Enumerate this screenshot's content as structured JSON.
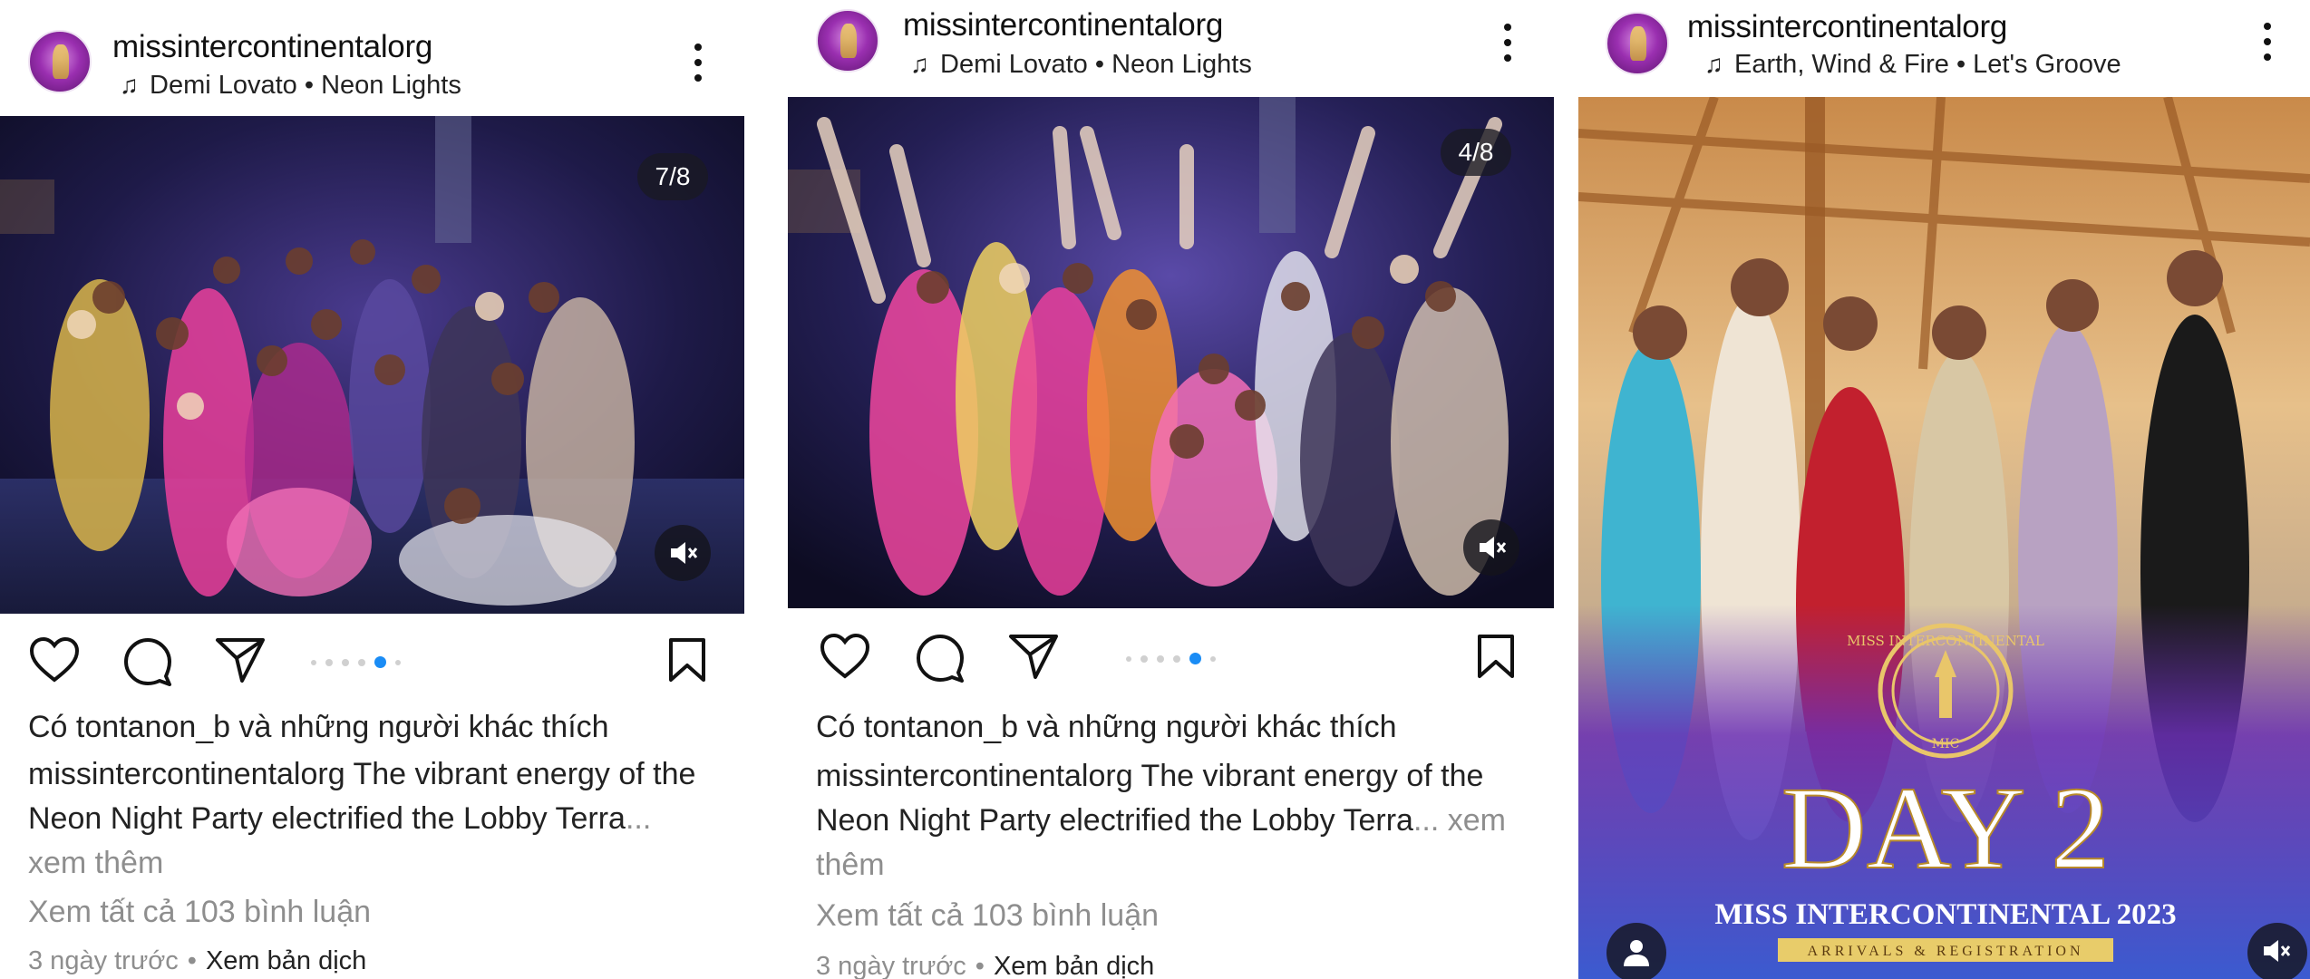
{
  "posts": [
    {
      "username": "missintercontinentalorg",
      "music": "Demi Lovato • Neon Lights",
      "counter": "7/8",
      "likes": "Có tontanon_b và những người khác thích",
      "caption": "missintercontinentalorg The vibrant energy of the Neon Night Party electrified the Lobby Terra",
      "caption_more": "... xem thêm",
      "comments": "Xem tất cả 103 bình luận",
      "time": "3 ngày trước",
      "translate": "Xem bản dịch",
      "carousel_active_index": 4,
      "carousel_dots": 6
    },
    {
      "username": "missintercontinentalorg",
      "music": "Demi Lovato • Neon Lights",
      "counter": "4/8",
      "likes": "Có tontanon_b và những người khác thích",
      "caption": "missintercontinentalorg The vibrant energy of the Neon Night Party electrified the Lobby Terra",
      "caption_more": "... xem thêm",
      "comments": "Xem tất cả 103 bình luận",
      "time": "3 ngày trước",
      "translate": "Xem bản dịch",
      "carousel_active_index": 4,
      "carousel_dots": 6
    },
    {
      "username": "missintercontinentalorg",
      "music": "Earth, Wind & Fire • Let's Groove",
      "overlay_logo_text": "MISS INTERCONTINENTAL",
      "overlay_logo_sub": "MIC",
      "overlay_title": "DAY 2",
      "overlay_subtitle": "MISS INTERCONTINENTAL 2023",
      "overlay_tagline": "ARRIVALS & REGISTRATION"
    }
  ],
  "icons": {
    "avatar": "avatar-logo",
    "music": "music-note-icon",
    "more": "more-vertical-icon",
    "like": "heart-icon",
    "comment": "comment-icon",
    "share": "send-icon",
    "save": "bookmark-icon",
    "mute": "muted-speaker-icon",
    "tag": "user-tag-icon"
  },
  "colors": {
    "accent": "#1a8cf5",
    "muted_text": "#8e8e8e",
    "text": "#222222"
  }
}
